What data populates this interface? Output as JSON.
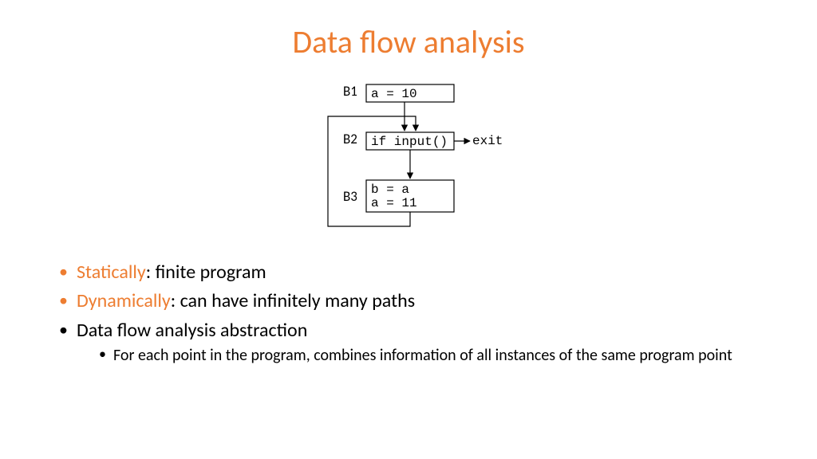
{
  "title": "Data flow analysis",
  "diagram": {
    "b1": {
      "label": "B1",
      "code": "a = 10"
    },
    "b2": {
      "label": "B2",
      "code": "if input()",
      "exit_label": "exit"
    },
    "b3": {
      "label": "B3",
      "code_line1": "b = a",
      "code_line2": "a = 11"
    }
  },
  "bullets": {
    "b1": {
      "accent": "Statically",
      "rest": ": finite program"
    },
    "b2": {
      "accent": "Dynamically",
      "rest": ": can have infinitely many paths"
    },
    "b3": {
      "text": "Data flow analysis abstraction"
    },
    "b3_sub": {
      "text": "For each point in the program, combines information of all instances of the same program point"
    }
  }
}
